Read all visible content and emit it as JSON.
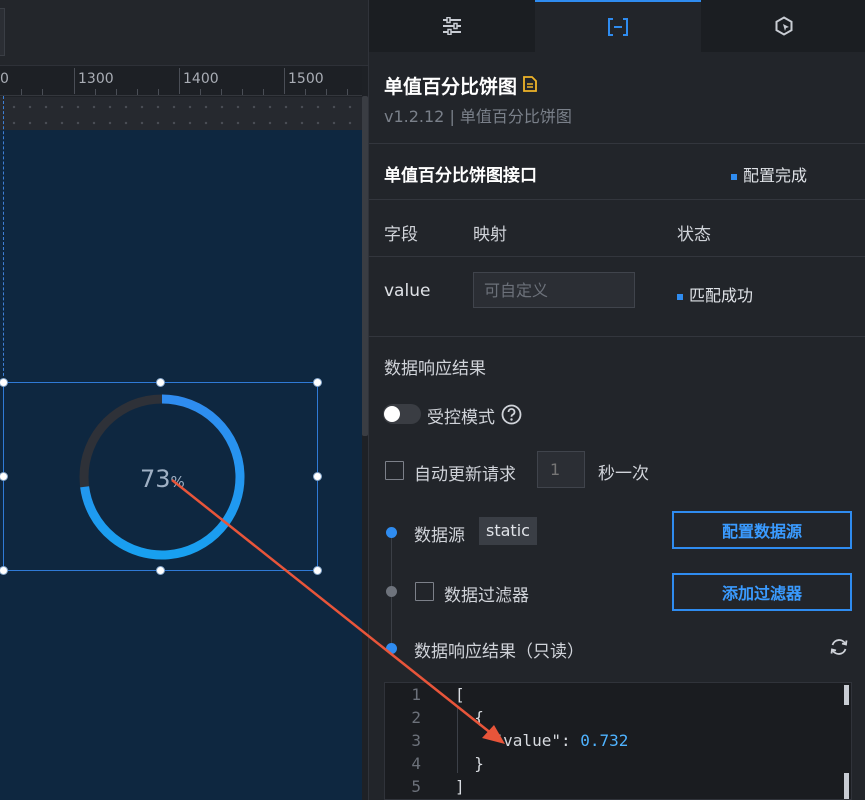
{
  "canvas": {
    "ruler_labels": [
      "0",
      "1300",
      "1400",
      "1500"
    ]
  },
  "widget": {
    "chart_data": {
      "type": "pie",
      "values": [
        73
      ],
      "value_label": "73",
      "unit": "%"
    },
    "colors": {
      "arc_start": "#2f8cf0",
      "arc_end": "#18a0f0",
      "track": "#2e3138"
    }
  },
  "panel": {
    "tabs": [
      {
        "name": "style",
        "icon": "sliders-icon"
      },
      {
        "name": "data",
        "icon": "data-bracket-icon"
      },
      {
        "name": "interaction",
        "icon": "cursor-hexagon-icon"
      }
    ],
    "component": {
      "title": "单值百分比饼图",
      "subtitle": "v1.2.12 | 单值百分比饼图"
    },
    "interface": {
      "title": "单值百分比饼图接口",
      "status": "配置完成"
    },
    "mapping_table": {
      "headers": [
        "字段",
        "映射",
        "状态"
      ],
      "rows": [
        {
          "field": "value",
          "placeholder": "可自定义",
          "status": "匹配成功"
        }
      ]
    },
    "result_section": {
      "heading": "数据响应结果",
      "controlled_mode": "受控模式",
      "auto_update": "自动更新请求",
      "interval_value": "1",
      "interval_unit": "秒一次",
      "source_label": "数据源",
      "source_tag": "static",
      "config_button": "配置数据源",
      "filter_label": "数据过滤器",
      "filter_button": "添加过滤器",
      "readonly_label": "数据响应结果（只读）"
    },
    "code": {
      "line_numbers": [
        "1",
        "2",
        "3",
        "4",
        "5"
      ],
      "lines": [
        "[",
        "  {",
        "    \"value\": ",
        "  }",
        "]"
      ],
      "value_number": "0.732"
    },
    "accent_color": "#2f8cf0"
  }
}
